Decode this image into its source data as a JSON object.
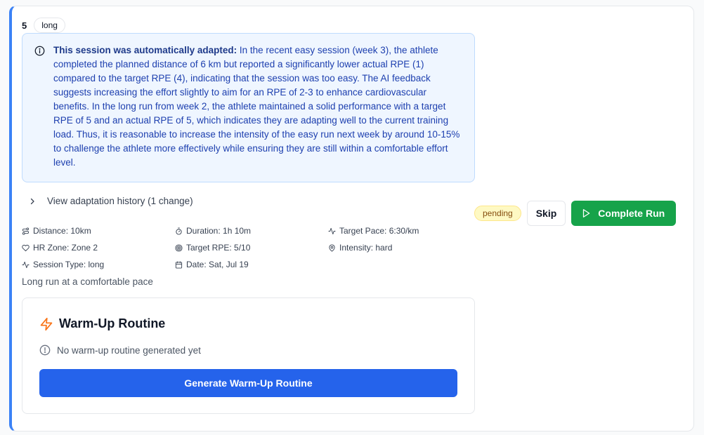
{
  "session": {
    "number": "5",
    "type_badge": "long",
    "status": "pending"
  },
  "adaptation": {
    "lead": "This session was automatically adapted:",
    "text": "In the recent easy session (week 3), the athlete completed the planned distance of 6 km but reported a significantly lower actual RPE (1) compared to the target RPE (4), indicating that the session was too easy. The AI feedback suggests increasing the effort slightly to aim for an RPE of 2-3 to enhance cardiovascular benefits. In the long run from week 2, the athlete maintained a solid performance with a target RPE of 5 and an actual RPE of 5, which indicates they are adapting well to the current training load. Thus, it is reasonable to increase the intensity of the easy run next week by around 10-15% to challenge the athlete more effectively while ensuring they are still within a comfortable effort level.",
    "history_label": "View adaptation history (1 change)"
  },
  "actions": {
    "skip_label": "Skip",
    "complete_label": "Complete Run"
  },
  "details": {
    "distance": "Distance: 10km",
    "duration": "Duration: 1h 10m",
    "target_pace": "Target Pace: 6:30/km",
    "hr_zone": "HR Zone: Zone 2",
    "target_rpe": "Target RPE: 5/10",
    "intensity": "Intensity: hard",
    "session_type": "Session Type: long",
    "date": "Date: Sat, Jul 19"
  },
  "description": "Long run at a comfortable pace",
  "warmup": {
    "title": "Warm-Up Routine",
    "empty_text": "No warm-up routine generated yet",
    "generate_label": "Generate Warm-Up Routine"
  },
  "colors": {
    "accent_border": "#3b82f6",
    "info_bg": "#eff6ff",
    "info_text": "#1e40af",
    "complete_button": "#16a34a",
    "generate_button": "#2563eb",
    "pending_badge": "#fef9c3",
    "warmup_icon": "#f97316"
  }
}
